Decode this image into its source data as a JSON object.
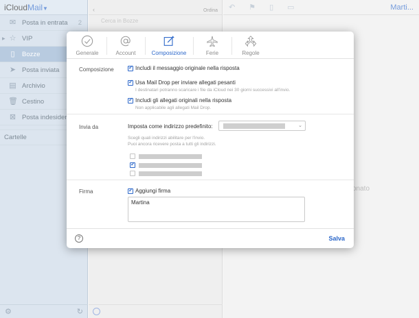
{
  "app": {
    "brand_prefix": "iCloud",
    "brand_mail": "Mail",
    "user": "Marti..."
  },
  "sidebar": {
    "items": [
      {
        "label": "Posta in entrata",
        "count": "2"
      },
      {
        "label": "VIP"
      },
      {
        "label": "Bozze"
      },
      {
        "label": "Posta inviata"
      },
      {
        "label": "Archivio"
      },
      {
        "label": "Cestino"
      },
      {
        "label": "Posta indesider..."
      }
    ],
    "section": "Cartelle"
  },
  "message_list": {
    "order_label": "Ordina",
    "search_placeholder": "Cerca in Bozze"
  },
  "reader": {
    "empty_text": "onato"
  },
  "modal": {
    "tabs": [
      {
        "label": "Generale"
      },
      {
        "label": "Account"
      },
      {
        "label": "Composizione"
      },
      {
        "label": "Ferie"
      },
      {
        "label": "Regole"
      }
    ],
    "composition": {
      "label": "Composizione",
      "include_original": "Includi il messaggio originale nella risposta",
      "mail_drop": "Usa Mail Drop per inviare allegati pesanti",
      "mail_drop_hint": "I destinatari potranno scaricare i file da iCloud nei 30 giorni successivi all'invio.",
      "include_attachments": "Includi gli allegati originali nella risposta",
      "include_attachments_hint": "Non applicabile agli allegati Mail Drop."
    },
    "send_from": {
      "label": "Invia da",
      "default_label": "Imposta come indirizzo predefinito:",
      "hint_1": "Scegli quali indirizzi abilitare per l'invio.",
      "hint_2": "Puoi ancora ricevere posta a tutti gli indirizzi."
    },
    "signature": {
      "label": "Firma",
      "add_signature": "Aggiungi firma",
      "text": "Martina"
    },
    "footer": {
      "help": "?",
      "save": "Salva"
    }
  },
  "colors": {
    "accent": "#2a66c9",
    "sidebar_bg": "#c9d8e6",
    "active_item": "#93b0cf"
  }
}
